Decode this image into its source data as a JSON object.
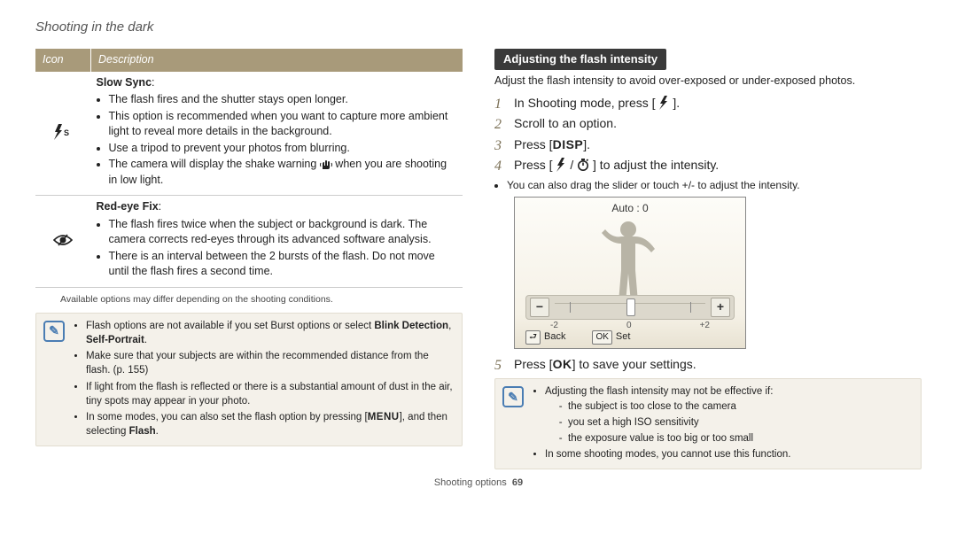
{
  "page_title": "Shooting in the dark",
  "table": {
    "header_icon": "Icon",
    "header_desc": "Description",
    "rows": [
      {
        "icon": "flash-slow-sync-icon",
        "title": "Slow Sync",
        "bullets": [
          "The flash fires and the shutter stays open longer.",
          "This option is recommended when you want to capture more ambient light to reveal more details in the background.",
          "Use a tripod to prevent your photos from blurring.",
          "The camera will display the shake warning (hand-shake-icon) when you are shooting in low light."
        ]
      },
      {
        "icon": "red-eye-fix-icon",
        "title": "Red-eye Fix",
        "bullets": [
          "The flash fires twice when the subject or background is dark. The camera corrects red-eyes through its advanced software analysis.",
          "There is an interval between the 2 bursts of the flash. Do not move until the flash fires a second time."
        ]
      }
    ]
  },
  "footnote": "Available options may differ depending on the shooting conditions.",
  "left_note": {
    "item1_pre": "Flash options are not available if you set Burst options or select ",
    "item1_bold1": "Blink Detection",
    "item1_mid": ", ",
    "item1_bold2": "Self-Portrait",
    "item1_after": ".",
    "item2": "Make sure that your subjects are within the recommended distance from the flash. (p. 155)",
    "item3": "If light from the flash is reflected or there is a substantial amount of dust in the air, tiny spots may appear in your photo.",
    "item4_pre": "In some modes, you can also set the flash option by pressing [",
    "item4_menu": "MENU",
    "item4_mid": "], and then selecting ",
    "item4_bold": "Flash",
    "item4_after": "."
  },
  "right": {
    "section_title": "Adjusting the flash intensity",
    "intro": "Adjust the flash intensity to avoid over-exposed or under-exposed photos.",
    "step1_pre": "In Shooting mode, press [",
    "step1_post": "].",
    "step2": "Scroll to an option.",
    "step3_pre": "Press [",
    "step3_disp": "DISP",
    "step3_post": "].",
    "step4_pre": "Press [",
    "step4_mid": "/",
    "step4_post": "] to adjust the intensity.",
    "step4_sub": "You can also drag the slider or touch +/- to adjust the intensity.",
    "screen": {
      "top_label": "Auto : 0",
      "minus": "−",
      "plus": "+",
      "tick_neg": "-2",
      "tick_zero": "0",
      "tick_pos": "+2",
      "back_label": "Back",
      "ok_label": "OK",
      "set_label": "Set"
    },
    "step5_pre": "Press [",
    "step5_ok": "OK",
    "step5_post": "] to save your settings.",
    "note": {
      "lead": "Adjusting the flash intensity may not be effective if:",
      "sub1": "the subject is too close to the camera",
      "sub2": "you set a high ISO sensitivity",
      "sub3": "the exposure value is too big or too small",
      "item2": "In some shooting modes, you cannot use this function."
    }
  },
  "footer": {
    "label": "Shooting options",
    "page": "69"
  }
}
